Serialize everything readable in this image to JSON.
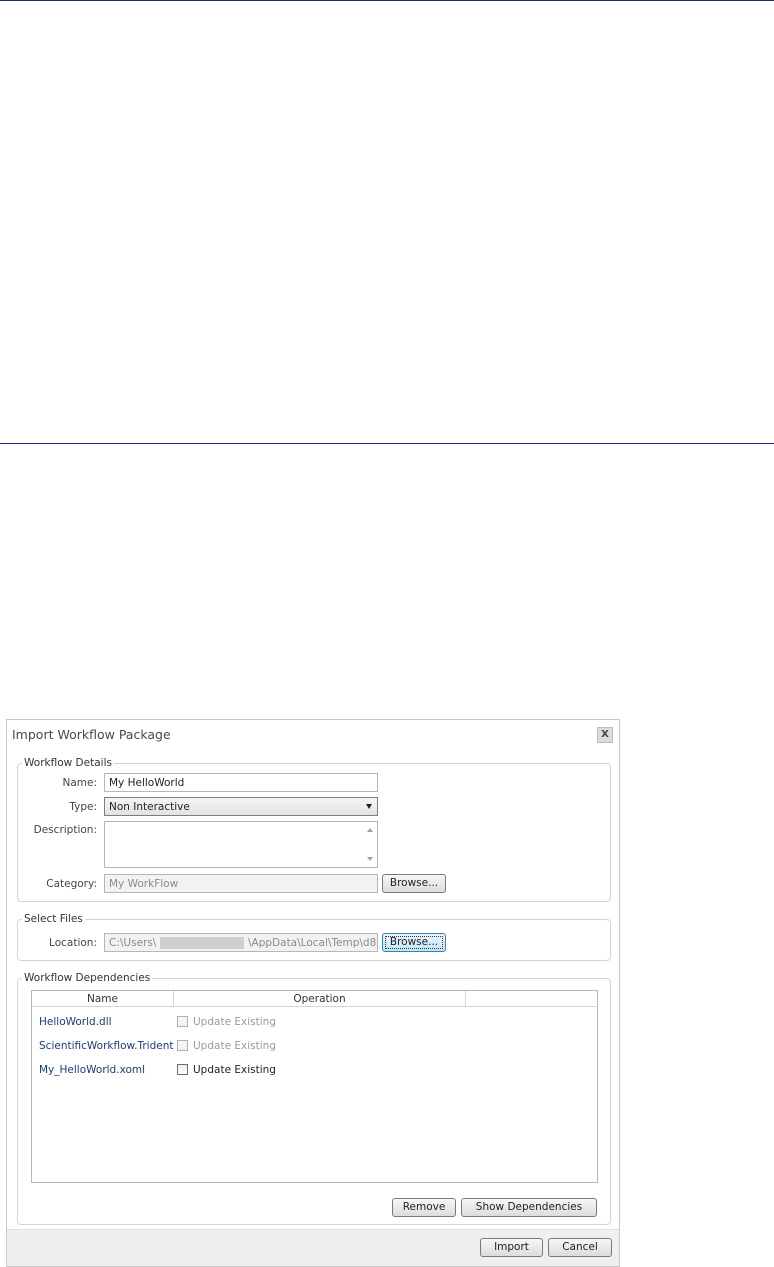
{
  "dialog": {
    "title": "Import Workflow Package",
    "close_label": "X"
  },
  "details": {
    "legend": "Workflow Details",
    "name_label": "Name:",
    "name_value": "My HelloWorld",
    "type_label": "Type:",
    "type_value": "Non Interactive",
    "description_label": "Description:",
    "category_label": "Category:",
    "category_value": "My WorkFlow",
    "browse_label": "Browse..."
  },
  "files": {
    "legend": "Select Files",
    "location_label": "Location:",
    "location_prefix": "C:\\Users\\",
    "location_suffix": "\\AppData\\Local\\Temp\\d8",
    "browse_label": "Browse..."
  },
  "dependencies": {
    "legend": "Workflow Dependencies",
    "columns": [
      "Name",
      "Operation"
    ],
    "rows": [
      {
        "name": "HelloWorld.dll",
        "operation": "Update Existing",
        "enabled": false
      },
      {
        "name": "ScientificWorkflow.Trident",
        "operation": "Update Existing",
        "enabled": false
      },
      {
        "name": "My_HelloWorld.xoml",
        "operation": "Update Existing",
        "enabled": true
      }
    ],
    "remove_label": "Remove",
    "show_dependencies_label": "Show Dependencies"
  },
  "footer": {
    "import_label": "Import",
    "cancel_label": "Cancel"
  },
  "colors": {
    "rule": "#1f2a6e",
    "link_text": "#1f3a7a",
    "focus_blue": "#3c7fb1"
  }
}
